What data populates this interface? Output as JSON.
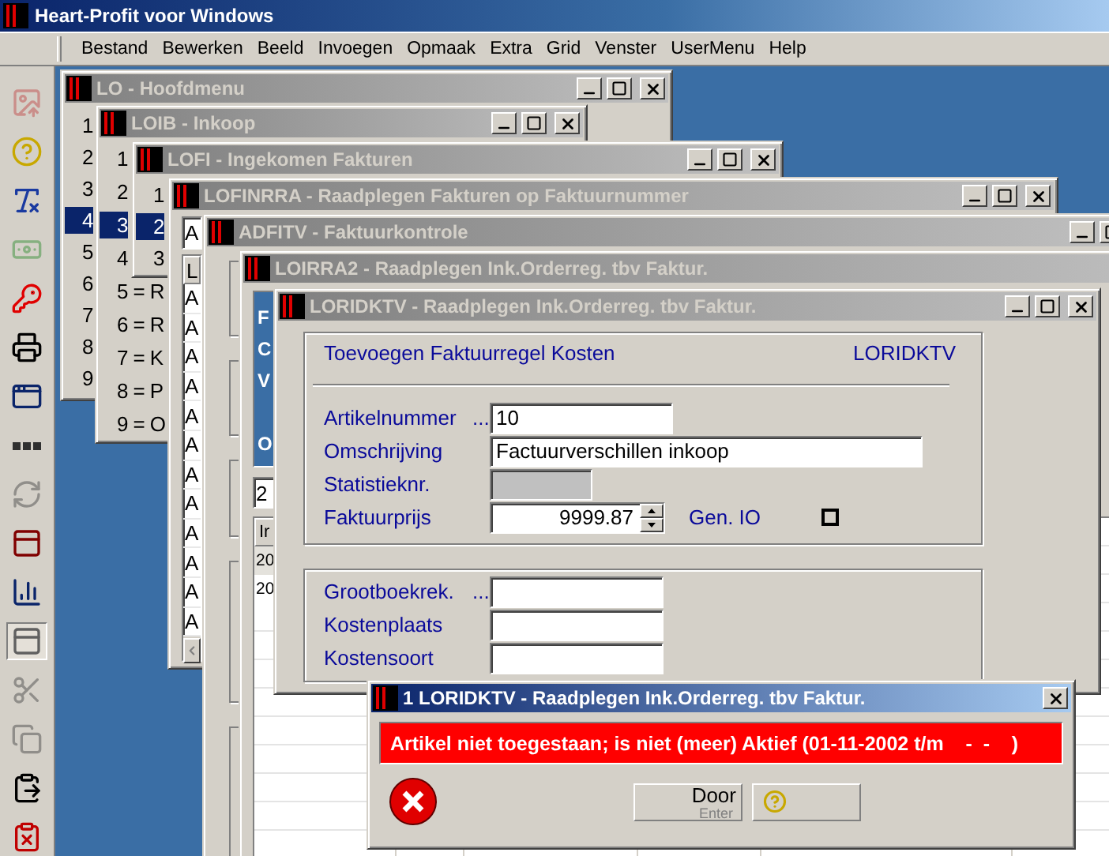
{
  "app": {
    "title": "Heart-Profit voor Windows"
  },
  "menu": [
    "Bestand",
    "Bewerken",
    "Beeld",
    "Invoegen",
    "Opmaak",
    "Extra",
    "Grid",
    "Venster",
    "UserMenu",
    "Help"
  ],
  "toolbar": [
    {
      "kind": "upload",
      "disabled": true,
      "pressed": false
    },
    {
      "kind": "help",
      "disabled": false,
      "pressed": false
    },
    {
      "kind": "font",
      "disabled": false,
      "pressed": false
    },
    {
      "kind": "money",
      "disabled": true,
      "pressed": false
    },
    {
      "kind": "key",
      "disabled": false,
      "pressed": false
    },
    {
      "kind": "print",
      "disabled": false,
      "pressed": false
    },
    {
      "kind": "form",
      "disabled": false,
      "pressed": false
    },
    {
      "kind": "dots",
      "disabled": false,
      "pressed": false
    },
    {
      "kind": "refresh",
      "disabled": true,
      "pressed": false
    },
    {
      "kind": "lock",
      "disabled": false,
      "pressed": false
    },
    {
      "kind": "chart",
      "disabled": false,
      "pressed": false
    },
    {
      "kind": "window",
      "disabled": false,
      "pressed": true
    },
    {
      "kind": "cut",
      "disabled": true,
      "pressed": false
    },
    {
      "kind": "copy",
      "disabled": true,
      "pressed": false
    },
    {
      "kind": "paste",
      "disabled": false,
      "pressed": false
    },
    {
      "kind": "paste-special",
      "disabled": false,
      "pressed": false
    }
  ],
  "windows": [
    {
      "kind": "menu",
      "title": "LO - Hoofdmenu",
      "active": false,
      "minimize_button": true,
      "maximize_button": true,
      "close_button": true,
      "items": [
        {
          "label": "1",
          "selected": false
        },
        {
          "label": "2",
          "selected": false
        },
        {
          "label": "3",
          "selected": false
        },
        {
          "label": "4",
          "selected": true
        },
        {
          "label": "5",
          "selected": false
        },
        {
          "label": "6",
          "selected": false
        },
        {
          "label": "7",
          "selected": false
        },
        {
          "label": "8",
          "selected": false
        },
        {
          "label": "9",
          "selected": false
        }
      ]
    },
    {
      "kind": "menu",
      "title": "LOIB - Inkoop",
      "active": false,
      "minimize_button": true,
      "maximize_button": true,
      "close_button": true,
      "items": [
        {
          "label": "1",
          "selected": false
        },
        {
          "label": "2",
          "selected": false
        },
        {
          "label": "3",
          "selected": true
        },
        {
          "label": "4",
          "selected": false
        },
        {
          "label": "5 = R",
          "selected": false
        },
        {
          "label": "6 = R",
          "selected": false
        },
        {
          "label": "7 = K",
          "selected": false
        },
        {
          "label": "8 = P",
          "selected": false
        },
        {
          "label": "9 = O",
          "selected": false
        }
      ]
    },
    {
      "kind": "menu",
      "title": "LOFI - Ingekomen Fakturen",
      "active": false,
      "minimize_button": true,
      "maximize_button": true,
      "close_button": true,
      "items": [
        {
          "label": "1",
          "selected": false
        },
        {
          "label": "2",
          "selected": true
        },
        {
          "label": "3",
          "selected": false
        }
      ]
    },
    {
      "kind": "lookup",
      "title": "LOFINRRA - Raadplegen Fakturen op Faktuurnummer",
      "active": false,
      "minimize_button": true,
      "maximize_button": true,
      "close_button": true,
      "field": "A",
      "header": "L",
      "rows": [
        "A",
        "A",
        "A",
        "A",
        "A",
        "A",
        "A",
        "A",
        "A",
        "A",
        "A",
        "A"
      ]
    },
    {
      "kind": "frames",
      "title": "ADFITV - Faktuurkontrole",
      "active": false,
      "minimize_button": true,
      "maximize_button": true,
      "close_button": false
    },
    {
      "kind": "order",
      "title": "LOIRRA2 - Raadplegen Ink.Orderreg. tbv Faktur.",
      "active": false,
      "minimize_button": false,
      "maximize_button": false,
      "close_button": false,
      "panel_lines": [
        "F",
        "C",
        "V",
        "O"
      ],
      "field": "2",
      "header": "Ir",
      "rows": [
        {
          "cell": "20",
          "selected": true
        },
        {
          "cell": "20",
          "selected": false
        }
      ]
    },
    {
      "kind": "form",
      "title": "LORIDKTV - Raadplegen Ink.Orderreg. tbv Faktur.",
      "active": false,
      "minimize_button": true,
      "maximize_button": true,
      "close_button": true,
      "form": {
        "heading": "Toevoegen Faktuurregel Kosten",
        "code": "LORIDKTV",
        "fields": [
          {
            "kind": "text",
            "label": "Artikelnummer",
            "suffix": "...",
            "value": "10"
          },
          {
            "kind": "wide",
            "label": "Omschrijving",
            "value": "Factuurverschillen inkoop"
          },
          {
            "kind": "readonly",
            "label": "Statistieknr."
          },
          {
            "kind": "spin",
            "label": "Faktuurprijs",
            "value": "9999.87"
          }
        ],
        "gen_io": {
          "label": "Gen. IO",
          "checked": false
        },
        "accounts": [
          {
            "label": "Grootboekrek.",
            "suffix": "..."
          },
          {
            "label": "Kostenplaats"
          },
          {
            "label": "Kostensoort"
          }
        ]
      }
    },
    {
      "kind": "message",
      "title": "1 LORIDKTV - Raadplegen Ink.Orderreg. tbv Faktur.",
      "active": true,
      "minimize_button": false,
      "maximize_button": false,
      "close_button": true,
      "message": "Artikel niet toegestaan; is niet (meer) Aktief (01-11-2002 t/m    -  -    )",
      "buttons": [
        {
          "kind": "primary",
          "label": "Door",
          "hint": "Enter"
        },
        {
          "kind": "help"
        }
      ]
    }
  ]
}
